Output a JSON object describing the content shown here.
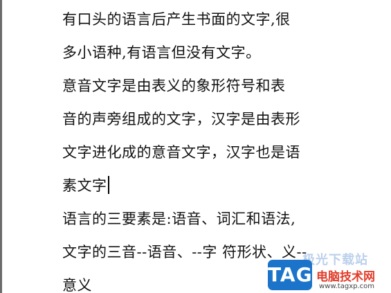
{
  "document": {
    "lines": [
      "有口头的语言后产生书面的文字,很",
      "多小语种,有语言但没有文字。",
      "意音文字是由表义的象形符号和表",
      "音的声旁组成的文字，汉字是由表形",
      "文字进化成的意音文字，汉字也是语",
      "素文字",
      "语言的三要素是:语音、词汇和语法,",
      "文字的三音--语音、--字 符形状、义--",
      "意义"
    ]
  },
  "watermark": {
    "ghost_text": "极光下载站",
    "logo_text": "TAG",
    "site_name": "电脑技术网",
    "url": "www.tagxp.com"
  }
}
